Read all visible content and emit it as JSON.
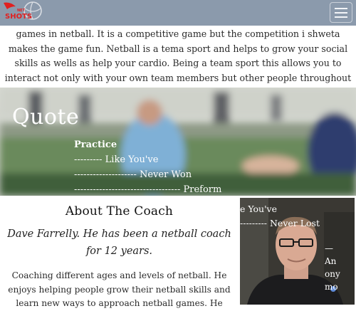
{
  "header": {
    "logo_text": "NET SHOTS",
    "menu_icon": "hamburger-menu-icon"
  },
  "intro": {
    "text": "games in netball. It is a competitive game but the competition i shweta makes the game fun. Netball is a tema sport and helps to grow your social skills as wells as help your cardio. Being a team sport this allows you to interact not only with your own team members but other people throughout the wellington region. It helps to create you a wide range of friend asn helps you gain more social confidence."
  },
  "quote": {
    "title": "Quote",
    "line1": "Practice",
    "line2": "--------- Like You've",
    "line3": "-------------------- Never Won",
    "line4": "---------------------------------- Preform"
  },
  "about": {
    "heading": "About The Coach",
    "lead": "Dave Farrelly. He has been a netball coach for 12 years.",
    "body": "Coaching different ages and levels of netball. He enjoys helping people grow their netball skills and learn new ways to approach netball games. He enjoys watching people grow and improve their"
  },
  "photo_overlay": {
    "line1": "e You've",
    "line2": "--------- Never Lost",
    "side1": "—",
    "side2": "An",
    "side3": "ony",
    "side4": "mo"
  },
  "colors": {
    "header_bg": "#7b8ca0",
    "logo_red": "#e02020"
  }
}
